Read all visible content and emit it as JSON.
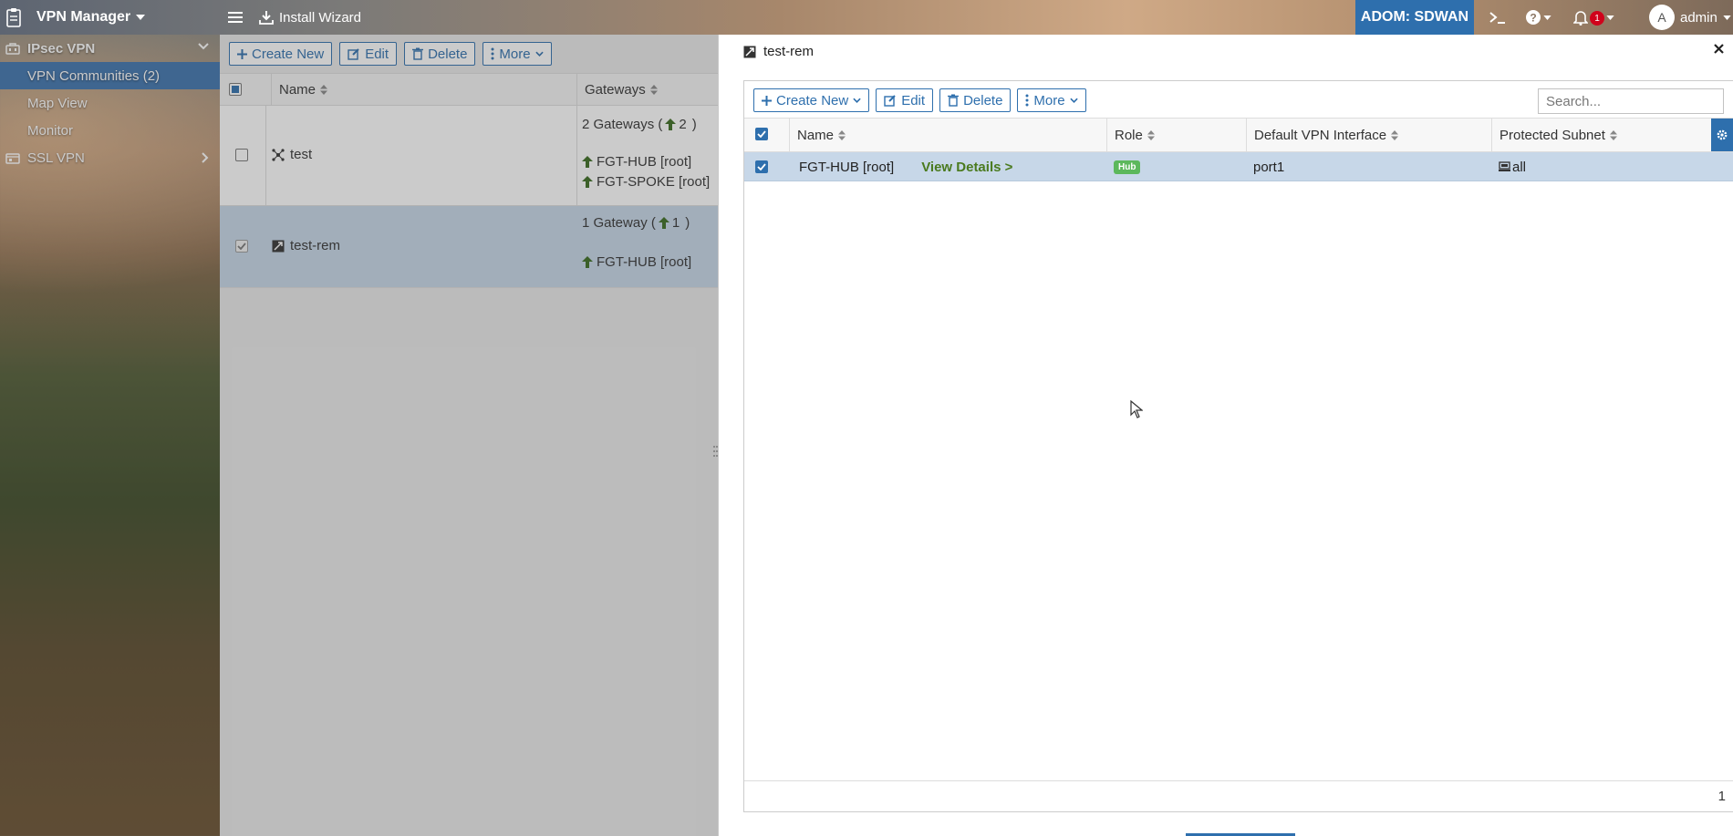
{
  "topbar": {
    "app_title": "VPN Manager",
    "install_wizard": "Install Wizard",
    "adom": "ADOM: SDWAN",
    "notification_count": "1",
    "avatar_letter": "A",
    "user": "admin"
  },
  "sidebar": {
    "group_ipsec": "IPsec VPN",
    "items": [
      {
        "label": "VPN Communities (2)",
        "active": true
      },
      {
        "label": "Map View",
        "active": false
      },
      {
        "label": "Monitor",
        "active": false
      }
    ],
    "group_ssl": "SSL VPN"
  },
  "left_grid": {
    "toolbar": {
      "create_new": "Create New",
      "edit": "Edit",
      "delete": "Delete",
      "more": "More"
    },
    "columns": [
      "Name",
      "Gateways"
    ],
    "rows": [
      {
        "name": "test",
        "summary_prefix": "2 Gateways (",
        "summary_count": "2",
        "summary_suffix": ")",
        "gateways": [
          "FGT-HUB [root]",
          "FGT-SPOKE [root]"
        ],
        "checked": false
      },
      {
        "name": "test-rem",
        "summary_prefix": "1 Gateway (",
        "summary_count": "1",
        "summary_suffix": ")",
        "gateways": [
          "FGT-HUB [root]"
        ],
        "checked": true
      }
    ]
  },
  "panel": {
    "title": "test-rem",
    "toolbar": {
      "create_new": "Create New",
      "edit": "Edit",
      "delete": "Delete",
      "more": "More"
    },
    "search_placeholder": "Search...",
    "columns": [
      "Name",
      "Role",
      "Default VPN Interface",
      "Protected Subnet"
    ],
    "rows": [
      {
        "name": "FGT-HUB [root]",
        "view_details": "View Details >",
        "role": "Hub",
        "interface": "port1",
        "subnet": "all",
        "checked": true
      }
    ],
    "page": "1"
  },
  "colors": {
    "accent": "#2e6fad",
    "selected_row": "#c7d7e8",
    "hub_badge": "#5cb85c",
    "view_details": "#4a7a1e",
    "notification": "#d0021b"
  }
}
